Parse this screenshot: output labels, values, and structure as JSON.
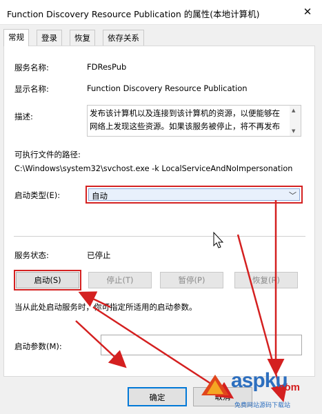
{
  "window": {
    "title": "Function Discovery Resource Publication 的属性(本地计算机)",
    "close_glyph": "✕"
  },
  "tabs": [
    {
      "label": "常规",
      "active": true
    },
    {
      "label": "登录",
      "active": false
    },
    {
      "label": "恢复",
      "active": false
    },
    {
      "label": "依存关系",
      "active": false
    }
  ],
  "general": {
    "service_name_label": "服务名称:",
    "service_name_value": "FDResPub",
    "display_name_label": "显示名称:",
    "display_name_value": "Function Discovery Resource Publication",
    "description_label": "描述:",
    "description_value": "发布该计算机以及连接到该计算机的资源，以便能够在网络上发现这些资源。如果该服务被停止，将不再发布",
    "exe_path_label": "可执行文件的路径:",
    "exe_path_value": "C:\\Windows\\system32\\svchost.exe -k LocalServiceAndNoImpersonation",
    "startup_type_label": "启动类型(E):",
    "startup_type_value": "自动",
    "startup_type_arrow": "﹀",
    "service_status_label": "服务状态:",
    "service_status_value": "已停止",
    "start_button": "启动(S)",
    "stop_button": "停止(T)",
    "pause_button": "暂停(P)",
    "resume_button": "恢复(R)",
    "hint_text": "当从此处启动服务时，你可指定所适用的启动参数。",
    "start_params_label": "启动参数(M):",
    "start_params_value": ""
  },
  "footer": {
    "ok_button": "确定",
    "cancel_button": "取消"
  },
  "watermark": {
    "logo_text": "aspku",
    "tld_text": ".com",
    "sub_text": "免费网站源码下载站"
  },
  "colors": {
    "annotation_red": "#d42020",
    "focus_blue": "#0078d7"
  }
}
